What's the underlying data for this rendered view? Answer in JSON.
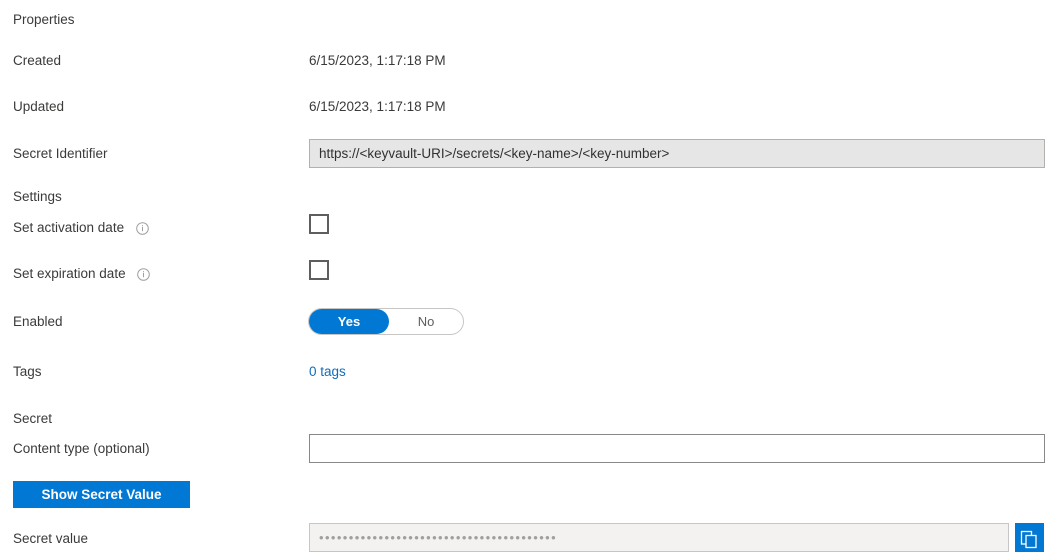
{
  "sections": {
    "properties_heading": "Properties",
    "settings_heading": "Settings",
    "secret_heading": "Secret"
  },
  "properties": {
    "created": {
      "label": "Created",
      "value": "6/15/2023, 1:17:18 PM"
    },
    "updated": {
      "label": "Updated",
      "value": "6/15/2023, 1:17:18 PM"
    },
    "secret_identifier": {
      "label": "Secret Identifier",
      "value": "https://<keyvault-URI>/secrets/<key-name>/<key-number>"
    }
  },
  "settings": {
    "set_activation_date": {
      "label": "Set activation date",
      "checked": false,
      "info_icon": "info-icon"
    },
    "set_expiration_date": {
      "label": "Set expiration date",
      "checked": false,
      "info_icon": "info-icon"
    },
    "enabled": {
      "label": "Enabled",
      "yes_label": "Yes",
      "no_label": "No",
      "selected": "Yes"
    },
    "tags": {
      "label": "Tags",
      "link_text": "0 tags"
    }
  },
  "secret": {
    "content_type": {
      "label": "Content type (optional)",
      "value": "",
      "placeholder": ""
    },
    "show_secret_button": "Show Secret Value",
    "secret_value": {
      "label": "Secret value",
      "masked_value": "••••••••••••••••••••••••••••••••••••••••",
      "copy_icon": "copy-icon"
    }
  },
  "colors": {
    "accent": "#0078d4",
    "link": "#0f6cbd",
    "text": "#3b3a39",
    "readonly_bg": "#e6e6e6",
    "disabled_bg": "#f3f2f1"
  }
}
